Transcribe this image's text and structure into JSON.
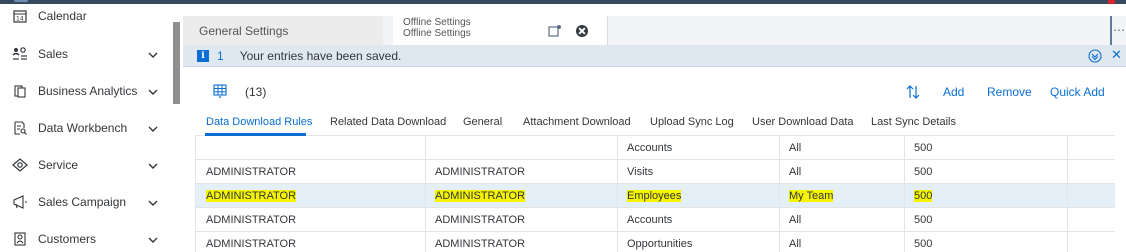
{
  "sidebar": {
    "items": [
      {
        "label": "Calendar",
        "icon": "calendar-icon",
        "icon_glyph": "14"
      },
      {
        "label": "Sales",
        "icon": "sales-icon"
      },
      {
        "label": "Business Analytics",
        "icon": "business-analytics-icon"
      },
      {
        "label": "Data Workbench",
        "icon": "data-workbench-icon"
      },
      {
        "label": "Service",
        "icon": "service-icon"
      },
      {
        "label": "Sales Campaign",
        "icon": "campaign-icon"
      },
      {
        "label": "Customers",
        "icon": "customers-icon"
      }
    ]
  },
  "doc_tabs": {
    "general": "General Settings",
    "offline_line1": "Offline Settings",
    "offline_line2": "Offline Settings"
  },
  "message_bar": {
    "count": "1",
    "text": "Your entries have been saved."
  },
  "toolbar": {
    "count": "(13)",
    "add": "Add",
    "remove": "Remove",
    "quick_add": "Quick Add"
  },
  "content_tabs": [
    "Data Download Rules",
    "Related Data Download",
    "General",
    "Attachment Download",
    "Upload Sync Log",
    "User Download Data",
    "Last Sync Details"
  ],
  "table": {
    "rows": [
      {
        "c1": "",
        "c2": "",
        "c3": "Accounts",
        "c4": "All",
        "c5": "500",
        "highlight": false
      },
      {
        "c1": "ADMINISTRATOR",
        "c2": "ADMINISTRATOR",
        "c3": "Visits",
        "c4": "All",
        "c5": "500",
        "highlight": false
      },
      {
        "c1": "ADMINISTRATOR",
        "c2": "ADMINISTRATOR",
        "c3": "Employees",
        "c4": "My Team",
        "c5": "500",
        "highlight": true
      },
      {
        "c1": "ADMINISTRATOR",
        "c2": "ADMINISTRATOR",
        "c3": "Accounts",
        "c4": "All",
        "c5": "500",
        "highlight": false
      },
      {
        "c1": "ADMINISTRATOR",
        "c2": "ADMINISTRATOR",
        "c3": "Opportunities",
        "c4": "All",
        "c5": "500",
        "highlight": false
      }
    ]
  },
  "colors": {
    "accent": "#0a6ed1",
    "shell": "#354a5f",
    "highlight_marker": "#f5f500",
    "selected_row": "#e5eff8",
    "message_bar": "#dfe8f1"
  }
}
